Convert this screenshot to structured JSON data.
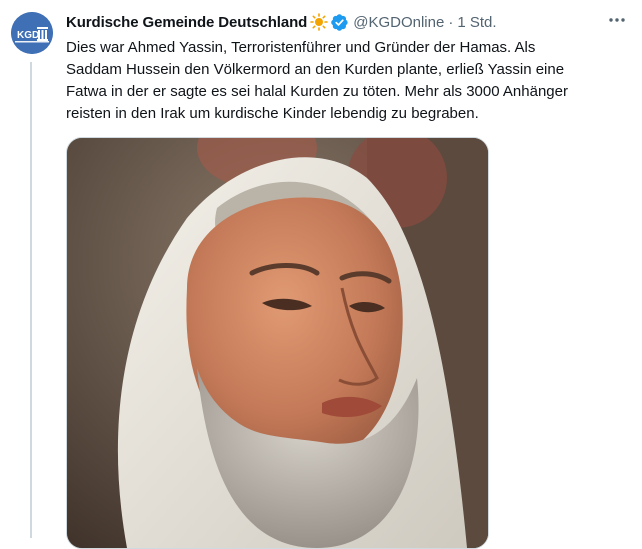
{
  "tweet": {
    "author_name": "Kurdische Gemeinde Deutschland",
    "handle": "@KGDOnline",
    "separator": "·",
    "time": "1 Std.",
    "lines": [
      "Dies war Ahmed Yassin, Terroristenführer und Gründer der Hamas. Als",
      "Saddam Hussein den Völkermord an den Kurden plante, erließ Yassin eine",
      "Fatwa in der er sagte es sei halal Kurden zu töten. Mehr als 3000 Anhänger",
      "reisten in den Irak um kurdische Kinder lebendig zu begraben."
    ],
    "avatar_text": "KGD",
    "name_emoji": "sun-icon",
    "badge_icon": "verified-badge-icon",
    "more_icon": "more-options-icon",
    "media_icon": "tweet-photo"
  },
  "colors": {
    "verified": "#1d9bf0",
    "secondary_text": "#536471",
    "avatar_bg": "#3f6fb4"
  }
}
